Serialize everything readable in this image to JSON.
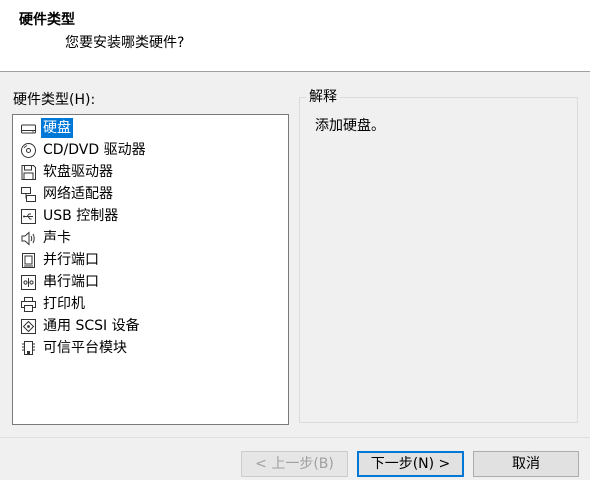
{
  "header": {
    "title": "硬件类型",
    "subtitle": "您要安装哪类硬件?"
  },
  "hardware": {
    "label": "硬件类型(H):",
    "items": [
      {
        "label": "硬盘",
        "icon": "hard-disk-icon",
        "selected": true
      },
      {
        "label": "CD/DVD 驱动器",
        "icon": "cd-dvd-icon",
        "selected": false
      },
      {
        "label": "软盘驱动器",
        "icon": "floppy-icon",
        "selected": false
      },
      {
        "label": "网络适配器",
        "icon": "network-adapter-icon",
        "selected": false
      },
      {
        "label": "USB 控制器",
        "icon": "usb-icon",
        "selected": false
      },
      {
        "label": "声卡",
        "icon": "speaker-icon",
        "selected": false
      },
      {
        "label": "并行端口",
        "icon": "parallel-port-icon",
        "selected": false
      },
      {
        "label": "串行端口",
        "icon": "serial-port-icon",
        "selected": false
      },
      {
        "label": "打印机",
        "icon": "printer-icon",
        "selected": false
      },
      {
        "label": "通用 SCSI 设备",
        "icon": "scsi-icon",
        "selected": false
      },
      {
        "label": "可信平台模块",
        "icon": "tpm-chip-icon",
        "selected": false
      }
    ]
  },
  "explanation": {
    "legend": "解释",
    "text": "添加硬盘。"
  },
  "buttons": {
    "back": "< 上一步(B)",
    "next": "下一步(N) >",
    "cancel": "取消"
  },
  "colors": {
    "selection": "#0078d7",
    "header_bg": "#ffffff",
    "dialog_bg": "#f0f0f0"
  }
}
